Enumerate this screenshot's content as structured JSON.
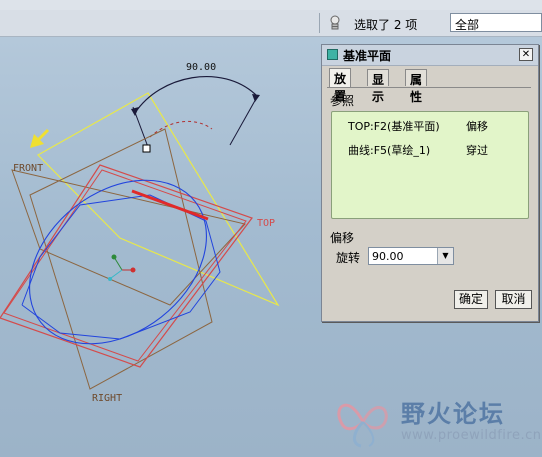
{
  "statusbar": {
    "selection_text": "选取了 2 项",
    "filter_value": "全部"
  },
  "viewport": {
    "dimension_value": "90.00",
    "plane_labels": {
      "front": "FRONT",
      "top": "TOP",
      "right": "RIGHT"
    }
  },
  "dialog": {
    "title": "基准平面",
    "close_glyph": "✕",
    "tabs": [
      {
        "label": "放置"
      },
      {
        "label": "显示"
      },
      {
        "label": "属性"
      }
    ],
    "references_label": "参照",
    "references": [
      {
        "ref": "TOP:F2(基准平面)",
        "constraint": "偏移"
      },
      {
        "ref": "曲线:F5(草绘_1)",
        "constraint": "穿过"
      }
    ],
    "offset_label": "偏移",
    "rotation_label": "旋转",
    "rotation_value": "90.00",
    "ok_label": "确定",
    "cancel_label": "取消"
  },
  "watermark": {
    "title": "野火论坛",
    "url": "www.proewildfire.cn"
  }
}
